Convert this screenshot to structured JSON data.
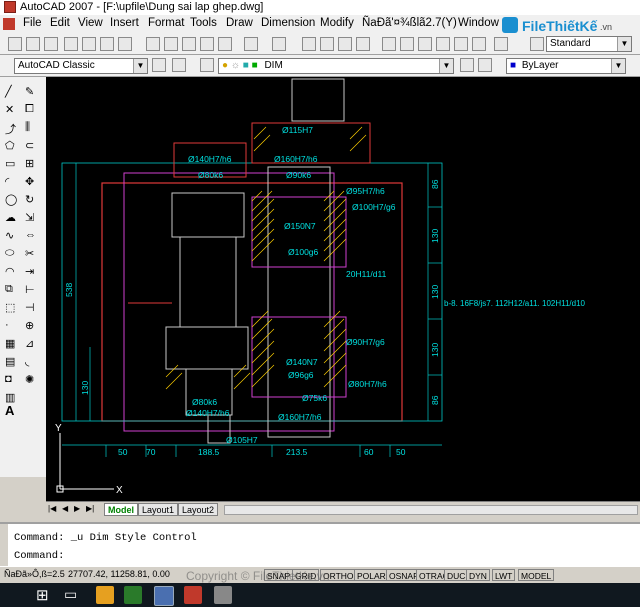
{
  "window": {
    "title": "AutoCAD 2007 - [F:\\upfile\\Dung sai lap ghep.dwg]"
  },
  "menu": [
    "File",
    "Edit",
    "View",
    "Insert",
    "Format",
    "Tools",
    "Draw",
    "Dimension",
    "Modify",
    "ÑaÐã'¤¾ßlã2.7(Y)",
    "Window"
  ],
  "watermark_logo": {
    "brand": "FileThiếtKế",
    "domain": ".vn"
  },
  "toolbar": {
    "text_style": "Standard",
    "workspace": "AutoCAD Classic",
    "layer": "DIM",
    "color": "ByLayer"
  },
  "drawing": {
    "dims": [
      "Ø115H7",
      "Ø140H7/h6",
      "Ø160H7/h6",
      "Ø90k6",
      "Ø80k6",
      "Ø95H7/h6",
      "Ø100H7/g6",
      "Ø150N7",
      "Ø100g6",
      "20H11/d11",
      "b-8. 16F8/js7. 112H12/a11. 102H11/d10",
      "Ø90H7/g6",
      "Ø140N7",
      "Ø96g6",
      "Ø80H7/h6",
      "Ø80k6",
      "Ø75k6",
      "Ø140H7/h6",
      "Ø160H7/h6",
      "Ø105H7"
    ],
    "horiz": [
      "50",
      "70",
      "188.5",
      "213.5",
      "60",
      "50"
    ],
    "vert_left": [
      "538",
      "130"
    ],
    "vert_right": [
      "86",
      "130",
      "130",
      "130",
      "86"
    ],
    "axis_x": "X",
    "axis_y": "Y"
  },
  "tabs": {
    "model": "Model",
    "layout1": "Layout1",
    "layout2": "Layout2"
  },
  "command": {
    "line1": "Command:  _u Dim Style Control",
    "line2": "Command:"
  },
  "status": {
    "scale": "ÑaÐã»Ô,ß=2.5",
    "coords": "27707.42, 11258.81, 0.00",
    "toggles": [
      "SNAP",
      "GRID",
      "ORTHO",
      "POLAR",
      "OSNAP",
      "OTRACK",
      "DUCS",
      "DYN",
      "LWT",
      "MODEL"
    ],
    "copyright": "Copyright © FileThietKe.vn"
  }
}
